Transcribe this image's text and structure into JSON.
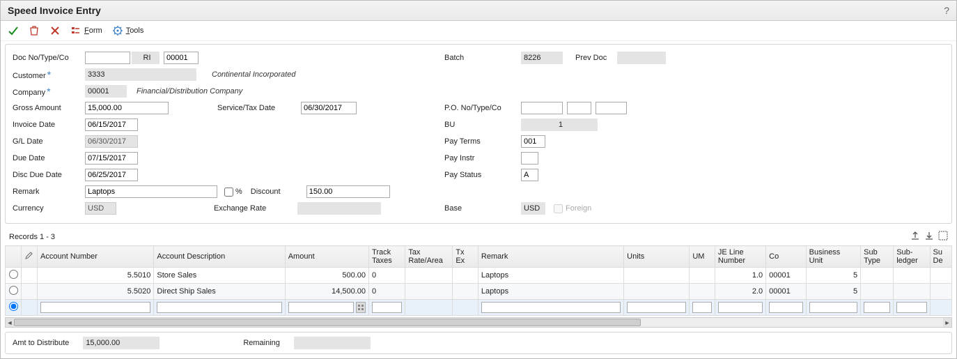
{
  "title": "Speed Invoice Entry",
  "toolbar": {
    "form_label": "Form",
    "tools_label": "Tools"
  },
  "labels": {
    "doc_no": "Doc No/Type/Co",
    "customer": "Customer",
    "company": "Company",
    "gross_amount": "Gross Amount",
    "invoice_date": "Invoice Date",
    "gl_date": "G/L Date",
    "due_date": "Due Date",
    "disc_due_date": "Disc Due Date",
    "remark": "Remark",
    "currency": "Currency",
    "service_tax_date": "Service/Tax Date",
    "discount": "Discount",
    "exchange_rate": "Exchange Rate",
    "batch": "Batch",
    "prev_doc": "Prev Doc",
    "po_no": "P.O. No/Type/Co",
    "bu": "BU",
    "pay_terms": "Pay Terms",
    "pay_instr": "Pay Instr",
    "pay_status": "Pay Status",
    "base": "Base",
    "foreign": "Foreign",
    "pct": "%"
  },
  "header": {
    "doc_no": "",
    "doc_type": "RI",
    "doc_co": "00001",
    "customer": "3333",
    "customer_name": "Continental Incorporated",
    "company": "00001",
    "company_name": "Financial/Distribution Company",
    "gross_amount": "15,000.00",
    "invoice_date": "06/15/2017",
    "gl_date": "06/30/2017",
    "due_date": "07/15/2017",
    "disc_due_date": "06/25/2017",
    "remark": "Laptops",
    "discount": "150.00",
    "currency": "USD",
    "exchange_rate": "",
    "service_tax_date": "06/30/2017",
    "batch": "8226",
    "prev_doc": "",
    "po_no": "",
    "po_type": "",
    "po_co": "",
    "bu": "1",
    "pay_terms": "001",
    "pay_instr": "",
    "pay_status": "A",
    "base": "USD"
  },
  "grid": {
    "record_text": "Records 1 - 3",
    "columns": [
      "",
      "",
      "Account Number",
      "Account Description",
      "Amount",
      "Track Taxes",
      "Tax Rate/Area",
      "Tx Ex",
      "Remark",
      "Units",
      "UM",
      "JE Line Number",
      "Co",
      "Business Unit",
      "Sub Type",
      "Sub- ledger",
      "Su De"
    ],
    "rows": [
      {
        "selected": false,
        "account": "5.5010",
        "desc": "Store Sales",
        "amount": "500.00",
        "track": "0",
        "tax": "",
        "txex": "",
        "remark": "Laptops",
        "units": "",
        "um": "",
        "je": "1.0",
        "co": "00001",
        "bu": "5",
        "subtype": "",
        "subledger": ""
      },
      {
        "selected": false,
        "account": "5.5020",
        "desc": "Direct Ship Sales",
        "amount": "14,500.00",
        "track": "0",
        "tax": "",
        "txex": "",
        "remark": "Laptops",
        "units": "",
        "um": "",
        "je": "2.0",
        "co": "00001",
        "bu": "5",
        "subtype": "",
        "subledger": ""
      }
    ]
  },
  "footer": {
    "amt_label": "Amt to Distribute",
    "amt_value": "15,000.00",
    "remaining_label": "Remaining",
    "remaining_value": ""
  }
}
